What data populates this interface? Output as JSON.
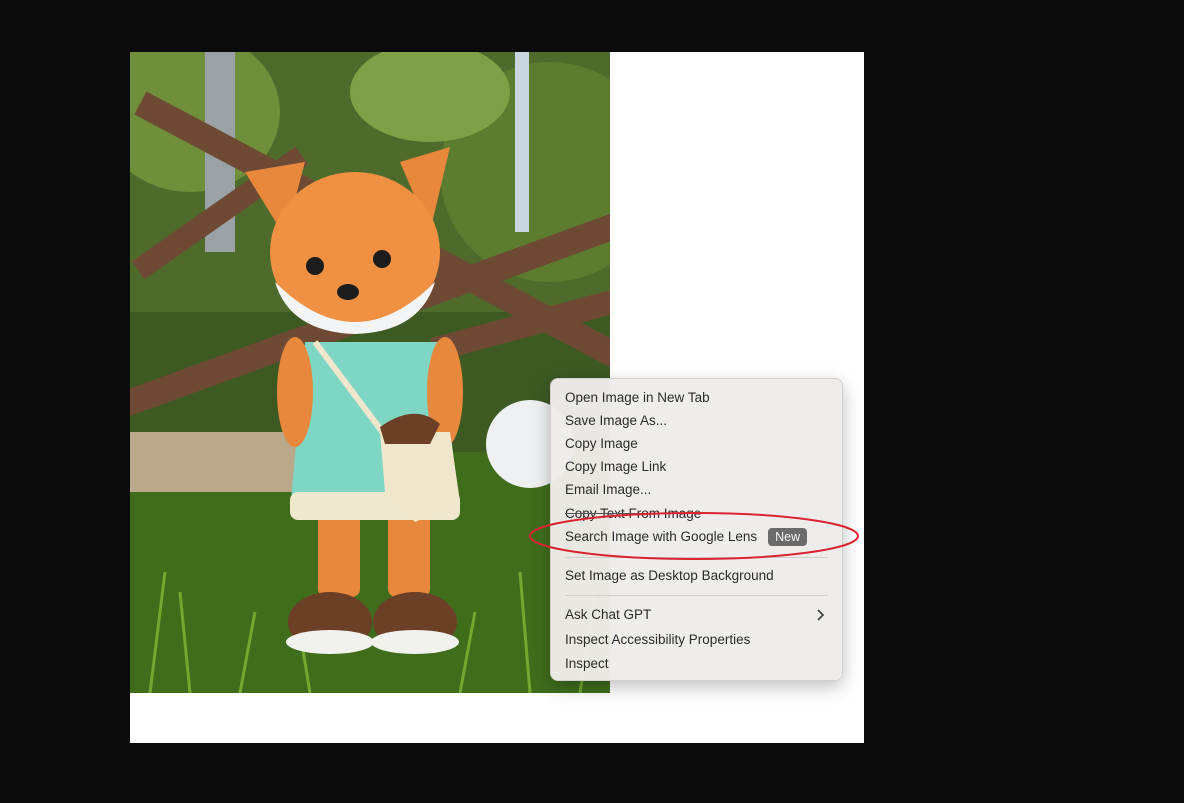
{
  "context_menu": {
    "items": [
      {
        "label": "Open Image in New Tab"
      },
      {
        "label": "Save Image As..."
      },
      {
        "label": "Copy Image"
      },
      {
        "label": "Copy Image Link"
      },
      {
        "label": "Email Image..."
      },
      {
        "label": "Copy Text From Image"
      },
      {
        "label": "Search Image with Google Lens",
        "badge": "New"
      },
      {
        "label": "Set Image as Desktop Background"
      },
      {
        "label": "Ask Chat GPT"
      },
      {
        "label": "Inspect Accessibility Properties"
      },
      {
        "label": "Inspect"
      }
    ]
  },
  "highlight": {
    "color": "#d9232e"
  },
  "colors": {
    "backdrop": "#0b0b0b",
    "menu_background": "#eeece9",
    "badge_background": "#6b6b6b"
  },
  "icons": {
    "submenu": "chevron-right-icon"
  }
}
